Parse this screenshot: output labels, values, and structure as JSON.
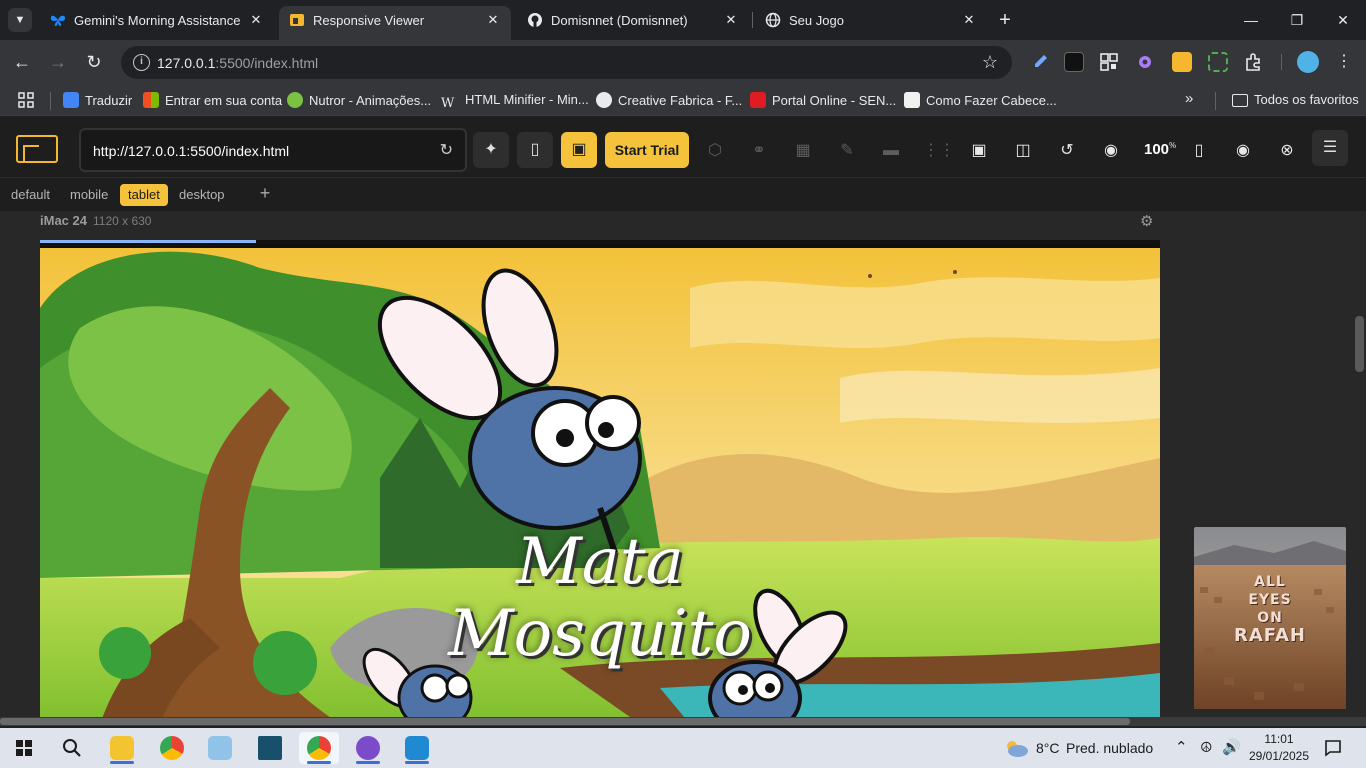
{
  "browser": {
    "tabs": [
      {
        "title": "Gemini's Morning Assistance | ..",
        "active": false
      },
      {
        "title": "Responsive Viewer",
        "active": true
      },
      {
        "title": "Domisnnet (Domisnnet)",
        "active": false
      },
      {
        "title": "Seu Jogo",
        "active": false
      }
    ],
    "url_host": "127.0.0.1",
    "url_rest": ":5500/index.html",
    "bookmarks": [
      {
        "label": "Traduzir",
        "color": "#4285f4"
      },
      {
        "label": "Entrar em sua conta",
        "color": "#f25022"
      },
      {
        "label": "Nutror - Animações...",
        "color": "#7cc242"
      },
      {
        "label": "HTML Minifier - Min...",
        "color": "#35363a"
      },
      {
        "label": "Creative Fabrica - F...",
        "color": "#e8eaed"
      },
      {
        "label": "Portal Online - SEN...",
        "color": "#e11b22"
      },
      {
        "label": "Como Fazer Cabece...",
        "color": "#f1f1f1"
      }
    ],
    "all_bookmarks": "Todos os favoritos"
  },
  "viewer": {
    "url_value": "http://127.0.0.1:5500/index.html",
    "start_trial": "Start Trial",
    "zoom": "100",
    "zoom_sup": "%",
    "accent": "#f5c33b",
    "presets": [
      "default",
      "mobile",
      "tablet",
      "desktop"
    ],
    "active_preset": "tablet",
    "add_preset": "+",
    "device": {
      "name": "iMac 24",
      "size": "1120 x 630"
    },
    "game_title_line1": "Mata",
    "game_title_line2": "Mosquito"
  },
  "floating_image": {
    "caption_line1": "ALL",
    "caption_line2": "EYES",
    "caption_line3": "ON",
    "caption_line4": "RAFAH"
  },
  "taskbar": {
    "weather_temp": "8°C",
    "weather_desc": "Pred. nublado",
    "time": "11:01",
    "date": "29/01/2025"
  }
}
